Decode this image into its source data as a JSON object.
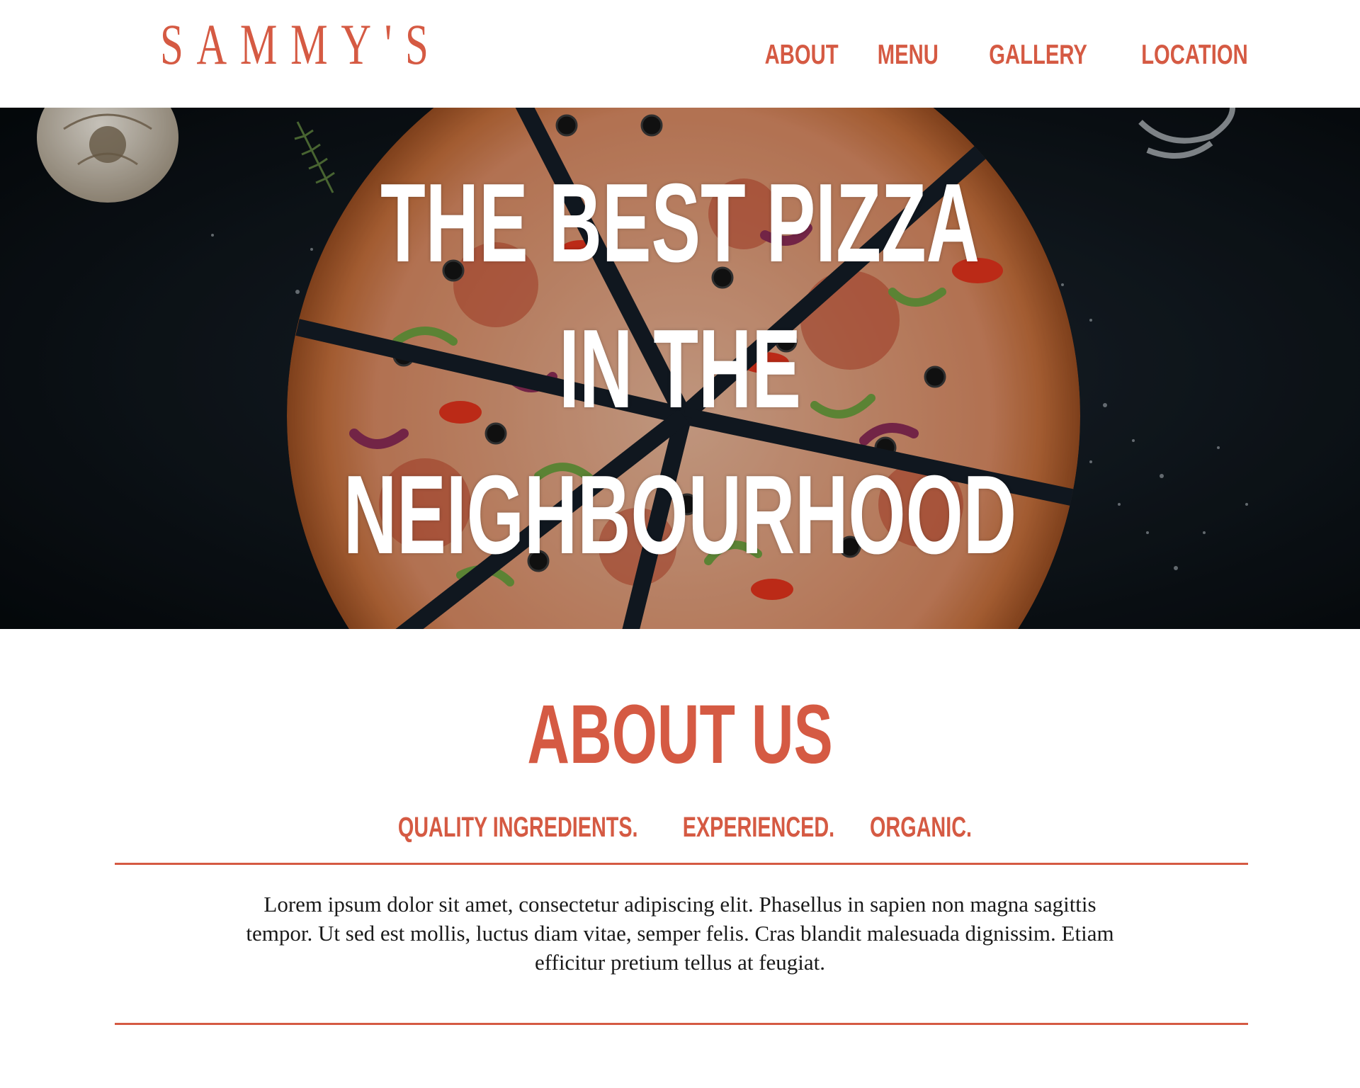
{
  "header": {
    "logo_text": "SAMMY'S",
    "nav": [
      {
        "label": "ABOUT"
      },
      {
        "label": "MENU"
      },
      {
        "label": "GALLERY"
      },
      {
        "label": "LOCATION"
      }
    ]
  },
  "hero": {
    "title_lines": [
      "THE BEST PIZZA",
      "IN THE",
      "NEIGHBOURHOOD"
    ]
  },
  "about": {
    "title": "ABOUT US",
    "tags": [
      "QUALITY INGREDIENTS.",
      "EXPERIENCED.",
      "ORGANIC."
    ],
    "body": "Lorem ipsum dolor sit amet, consectetur adipiscing elit. Phasellus in sapien non magna sagittis tempor. Ut sed est mollis, luctus diam vitae, semper felis. Cras blandit malesuada dignissim. Etiam efficitur pretium tellus at feugiat."
  },
  "colors": {
    "accent": "#d55a43",
    "hero_background": "#0f161d",
    "body_text": "#1a1a1a",
    "page_background": "#ffffff"
  }
}
